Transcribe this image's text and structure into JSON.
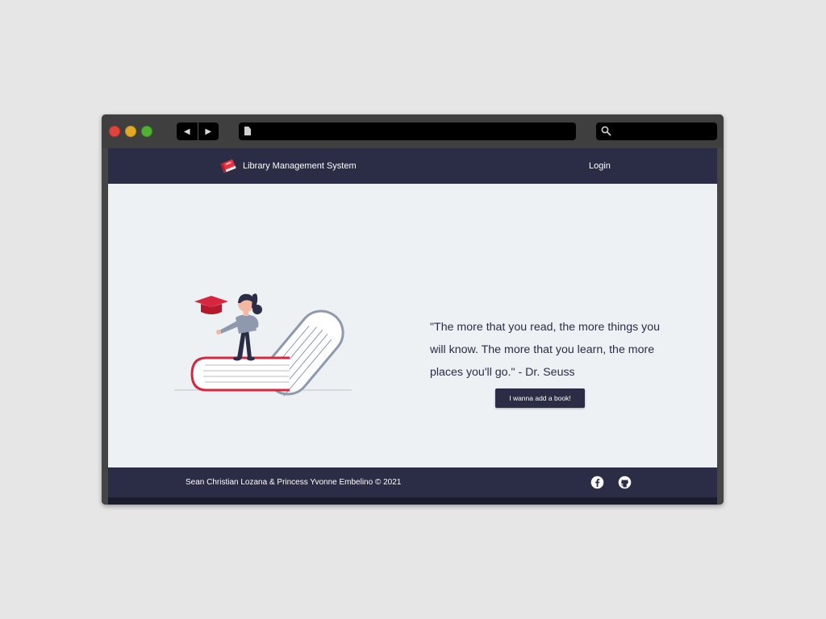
{
  "window": {
    "nav_back": "◀",
    "nav_forward": "▶"
  },
  "header": {
    "brand": "Library Management System",
    "login": "Login"
  },
  "hero": {
    "quote": "\"The more that you read, the more things you will know. The more that you learn, the more places you'll go.\" - Dr. Seuss",
    "cta": "I wanna add a book!"
  },
  "footer": {
    "credit": "Sean Christian Lozana & Princess Yvonne Embelino © 2021"
  },
  "icons": [
    "book-icon",
    "facebook-icon",
    "github-icon",
    "search-icon",
    "document-icon"
  ],
  "colors": {
    "navy": "#2a2d45",
    "accent_red": "#d7263d",
    "page_bg": "#edf1f4"
  }
}
